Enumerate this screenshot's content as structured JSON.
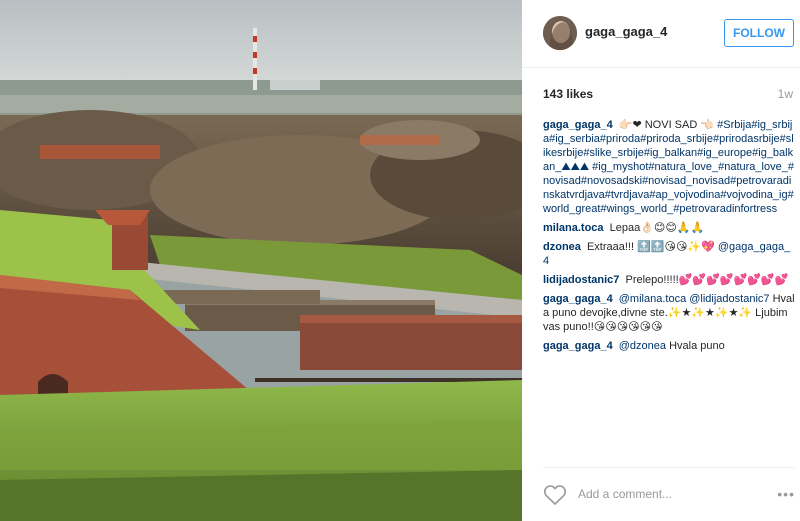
{
  "post": {
    "username": "gaga_gaga_4",
    "follow_label": "FOLLOW",
    "likes": "143 likes",
    "time": "1w",
    "add_comment_placeholder": "Add a comment...",
    "more_label": "•••"
  },
  "caption": {
    "user": "gaga_gaga_4",
    "text": "👉🏻❤ NOVI SAD 👈🏻",
    "tags": "#Srbija#ig_srbija#ig_serbia#priroda#priroda_srbije#prirodasrbije#slikesrbije#slike_srbije#ig_balkan#ig_europe#ig_balkan_⛰⛰⛰ #ig_myshot#natura_love_#natura_love_#novisad#novosadski#novisad_novisad#petrovaradinskatvrdjava#tvrdjava#ap_vojvodina#vojvodina_ig#world_great#wings_world_#petrovaradinfortress"
  },
  "comments": [
    {
      "user": "milana.toca",
      "text": "Lepaa👌🏻😊😊🙏🙏"
    },
    {
      "user": "dzonea",
      "text": "Extraaa!!! 🔝🔝😘😘✨💖",
      "mention": "@gaga_gaga_4"
    },
    {
      "user": "lidijadostanic7",
      "text": "Prelepo!!!!!💕💕💕💕💕💕💕💕"
    },
    {
      "user": "gaga_gaga_4",
      "mention": "@milana.toca @lidijadostanic7",
      "text": "Hvala puno devojke,divne ste.✨★✨★✨★✨ Ljubim vas puno!!😘😘😘😘😘😘"
    },
    {
      "user": "gaga_gaga_4",
      "mention": "@dzonea",
      "text": "Hvala puno"
    }
  ],
  "colors": {
    "accent": "#3897f0",
    "link": "#003569",
    "text": "#262626",
    "muted": "#999999"
  },
  "icons": {
    "like": "heart-icon",
    "more": "more-icon"
  }
}
